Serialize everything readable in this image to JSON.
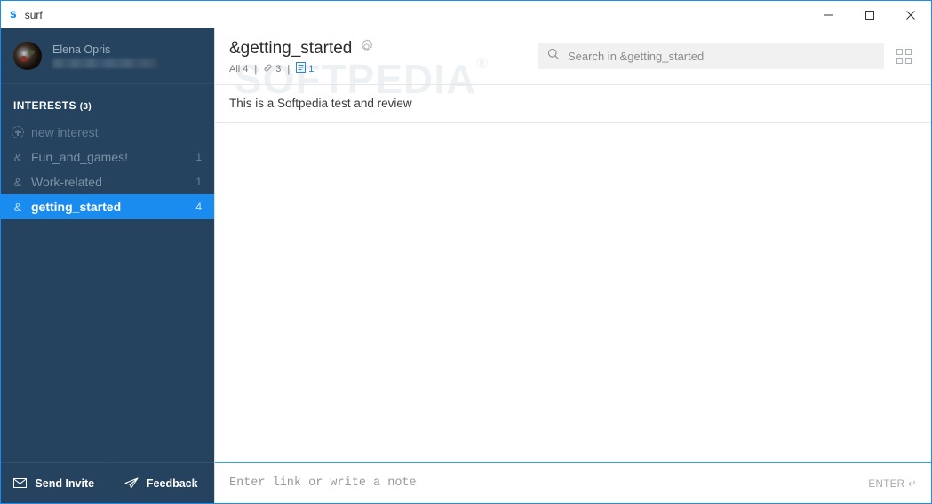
{
  "titlebar": {
    "app_icon": "s-logo-icon",
    "title": "surf",
    "minimize": "minimize-icon",
    "maximize": "maximize-icon",
    "close": "close-icon"
  },
  "sidebar": {
    "profile": {
      "name": "Elena Opris",
      "email_redacted": ""
    },
    "section_title": "INTERESTS",
    "section_count": "(3)",
    "new_interest_label": "new interest",
    "items": [
      {
        "glyph": "&",
        "label": "Fun_and_games!",
        "count": "1",
        "selected": false
      },
      {
        "glyph": "&",
        "label": "Work-related",
        "count": "1",
        "selected": false
      },
      {
        "glyph": "&",
        "label": "getting_started",
        "count": "4",
        "selected": true
      }
    ],
    "bottom": {
      "send_invite": "Send Invite",
      "feedback": "Feedback"
    }
  },
  "main": {
    "board_title": "&getting_started",
    "settings_icon": "gear-icon",
    "filters": [
      {
        "label": "All",
        "count": "4",
        "active": false
      },
      {
        "label": "link",
        "count": "3",
        "active": false
      },
      {
        "label": "note",
        "count": "1",
        "active": true
      }
    ],
    "search": {
      "placeholder": "Search in &getting_started",
      "value": ""
    },
    "grid_view_icon": "grid-view-icon",
    "watermark": "SOFTPEDIA",
    "watermark_reg": "®",
    "items": [
      {
        "text": "This is a Softpedia test and review"
      }
    ],
    "composer": {
      "placeholder": "Enter link or write a note",
      "value": "",
      "enter_hint": "ENTER ↵"
    }
  },
  "colors": {
    "accent": "#1a8cf0",
    "sidebar_bg": "#25435e",
    "window_border": "#1a8cf0",
    "composer_border": "#2fa3e8"
  }
}
